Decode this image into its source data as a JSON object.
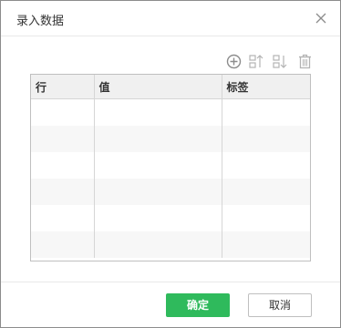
{
  "dialog": {
    "title": "录入数据",
    "close_icon": "close-icon"
  },
  "toolbar": {
    "icons": [
      "add-circle-icon",
      "sort-up-icon",
      "sort-down-icon",
      "trash-icon"
    ],
    "icon_color": "#b3b3b3"
  },
  "table": {
    "columns": [
      "行",
      "值",
      "标签"
    ],
    "rows": [
      [
        "",
        "",
        ""
      ],
      [
        "",
        "",
        ""
      ],
      [
        "",
        "",
        ""
      ],
      [
        "",
        "",
        ""
      ],
      [
        "",
        "",
        ""
      ],
      [
        "",
        "",
        ""
      ]
    ]
  },
  "footer": {
    "ok_label": "确定",
    "cancel_label": "取消"
  },
  "colors": {
    "accent": "#2fba5c"
  }
}
